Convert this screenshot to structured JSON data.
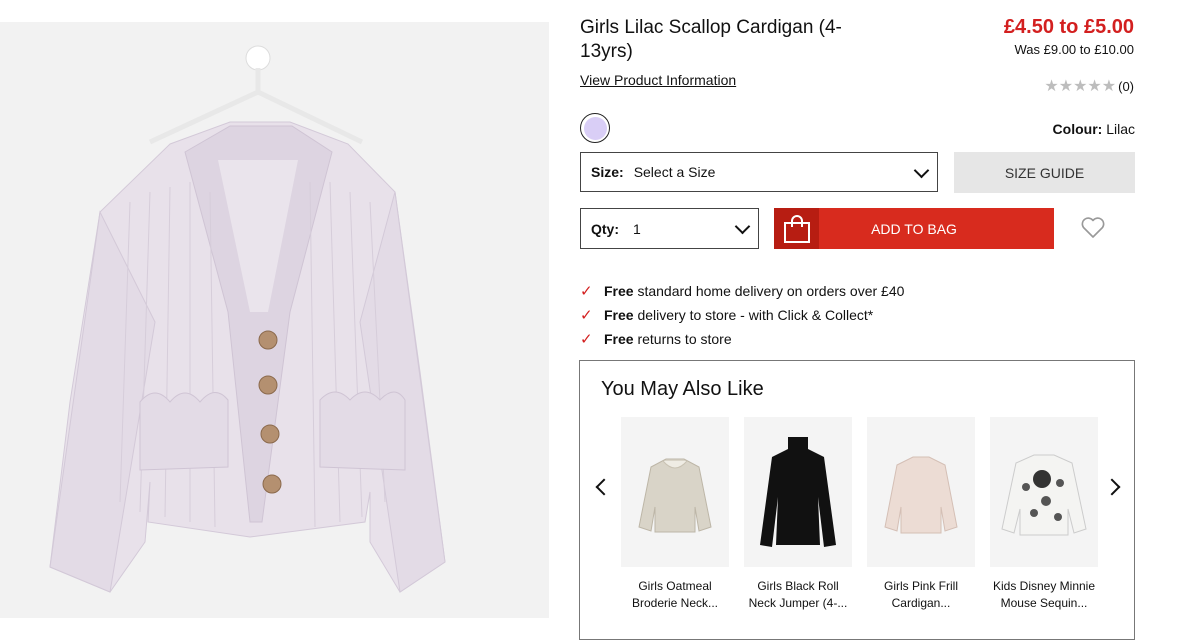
{
  "product": {
    "title": "Girls Lilac Scallop Cardigan (4-13yrs)",
    "view_info_label": "View Product Information",
    "price": "£4.50 to £5.00",
    "was_price": "Was £9.00 to £10.00",
    "rating_count": "(0)",
    "rating_stars": 0,
    "colour_label": "Colour:",
    "colour_value": "Lilac",
    "swatch_color": "#d9cef6"
  },
  "size": {
    "label": "Size:",
    "value": "Select a Size",
    "guide_label": "SIZE GUIDE"
  },
  "qty": {
    "label": "Qty:",
    "value": "1"
  },
  "add_to_bag_label": "ADD TO BAG",
  "benefits": [
    {
      "bold": "Free",
      "text": "standard home delivery on orders over £40"
    },
    {
      "bold": "Free",
      "text": "delivery to store - with Click & Collect*"
    },
    {
      "bold": "Free",
      "text": "returns to store"
    }
  ],
  "also_like": {
    "title": "You May Also Like",
    "items": [
      {
        "line1": "Girls Oatmeal",
        "line2": "Broderie Neck..."
      },
      {
        "line1": "Girls Black Roll",
        "line2": "Neck Jumper (4-..."
      },
      {
        "line1": "Girls Pink Frill",
        "line2": "Cardigan..."
      },
      {
        "line1": "Kids Disney Minnie",
        "line2": "Mouse Sequin..."
      }
    ]
  },
  "colors": {
    "price_red": "#d31f1f",
    "button_red": "#d82b1e",
    "cardigan_lilac": "#e6dde9"
  }
}
